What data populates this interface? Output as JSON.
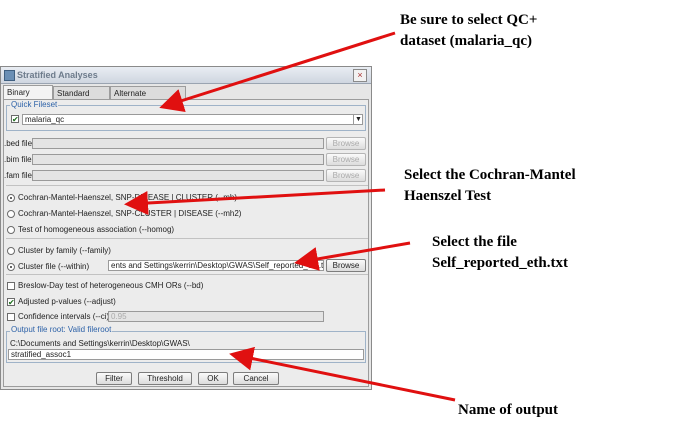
{
  "window": {
    "title": "Stratified Analyses",
    "close_label": "×",
    "tabs": [
      "Binary Input",
      "Standard Input",
      "Alternate Phenotype"
    ]
  },
  "quick_fileset": {
    "label": "Quick Fileset",
    "value": "malaria_qc"
  },
  "files": {
    "bed_label": ".bed file",
    "bim_label": ".bim file",
    "fam_label": ".fam file",
    "browse_label": "Browse"
  },
  "tests": [
    {
      "label": "Cochran-Mantel-Haenszel, SNP-DISEASE | CLUSTER (--mh)",
      "selected": true
    },
    {
      "label": "Cochran-Mantel-Haenszel, SNP-CLUSTER | DISEASE (--mh2)",
      "selected": false
    },
    {
      "label": "Test of homogeneous association (--homog)",
      "selected": false
    }
  ],
  "cluster": {
    "family_label": "Cluster by family (--family)",
    "file_label": "Cluster file (--within)",
    "file_value": "ents and Settings\\kerrin\\Desktop\\GWAS\\Self_reported_eth.txt",
    "browse_label": "Browse"
  },
  "options": {
    "breslow_label": "Breslow-Day test of heterogeneous CMH ORs (--bd)",
    "adjusted_label": "Adjusted p-values (--adjust)",
    "adjusted_checked": "✔",
    "ci_label": "Confidence intervals (--ci)",
    "ci_value": "0.95"
  },
  "output": {
    "group_label": "Output file root: Valid fileroot",
    "path": "C:\\Documents and Settings\\kerrin\\Desktop\\GWAS\\",
    "name": "stratified_assoc1"
  },
  "buttons": {
    "filter": "Filter",
    "threshold": "Threshold",
    "ok": "OK",
    "cancel": "Cancel"
  },
  "annotations": {
    "qc_line1": "Be sure to select QC+",
    "qc_line2": "dataset (malaria_qc)",
    "cmh_line1": "Select the Cochran-Mantel",
    "cmh_line2": "Haenszel Test",
    "file_line1": "Select the file",
    "file_line2": "Self_reported_eth.txt",
    "output_label": "Name of  output"
  },
  "colors": {
    "arrow": "#e01010",
    "group_label": "#2d62a8"
  }
}
